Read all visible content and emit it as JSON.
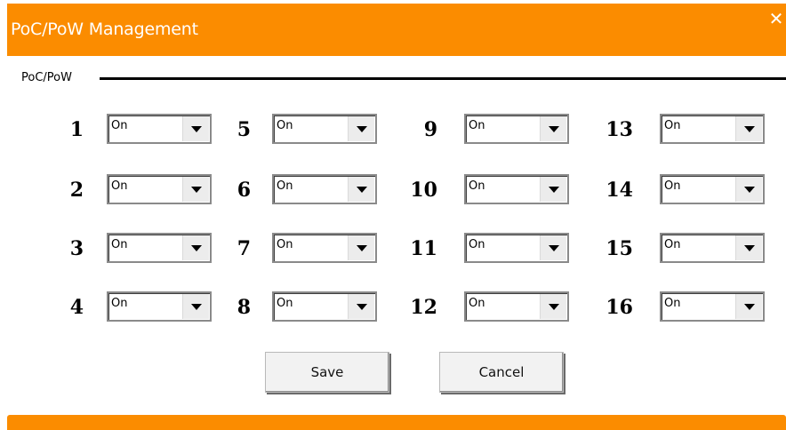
{
  "window": {
    "title": "PoC/PoW Management",
    "close_glyph": "✕"
  },
  "group": {
    "label": "PoC/PoW"
  },
  "ports": [
    {
      "num": "1",
      "value": "On"
    },
    {
      "num": "2",
      "value": "On"
    },
    {
      "num": "3",
      "value": "On"
    },
    {
      "num": "4",
      "value": "On"
    },
    {
      "num": "5",
      "value": "On"
    },
    {
      "num": "6",
      "value": "On"
    },
    {
      "num": "7",
      "value": "On"
    },
    {
      "num": "8",
      "value": "On"
    },
    {
      "num": "9",
      "value": "On"
    },
    {
      "num": "10",
      "value": "On"
    },
    {
      "num": "11",
      "value": "On"
    },
    {
      "num": "12",
      "value": "On"
    },
    {
      "num": "13",
      "value": "On"
    },
    {
      "num": "14",
      "value": "On"
    },
    {
      "num": "15",
      "value": "On"
    },
    {
      "num": "16",
      "value": "On"
    }
  ],
  "buttons": {
    "save": "Save",
    "cancel": "Cancel"
  },
  "colors": {
    "accent": "#fb8c00"
  }
}
